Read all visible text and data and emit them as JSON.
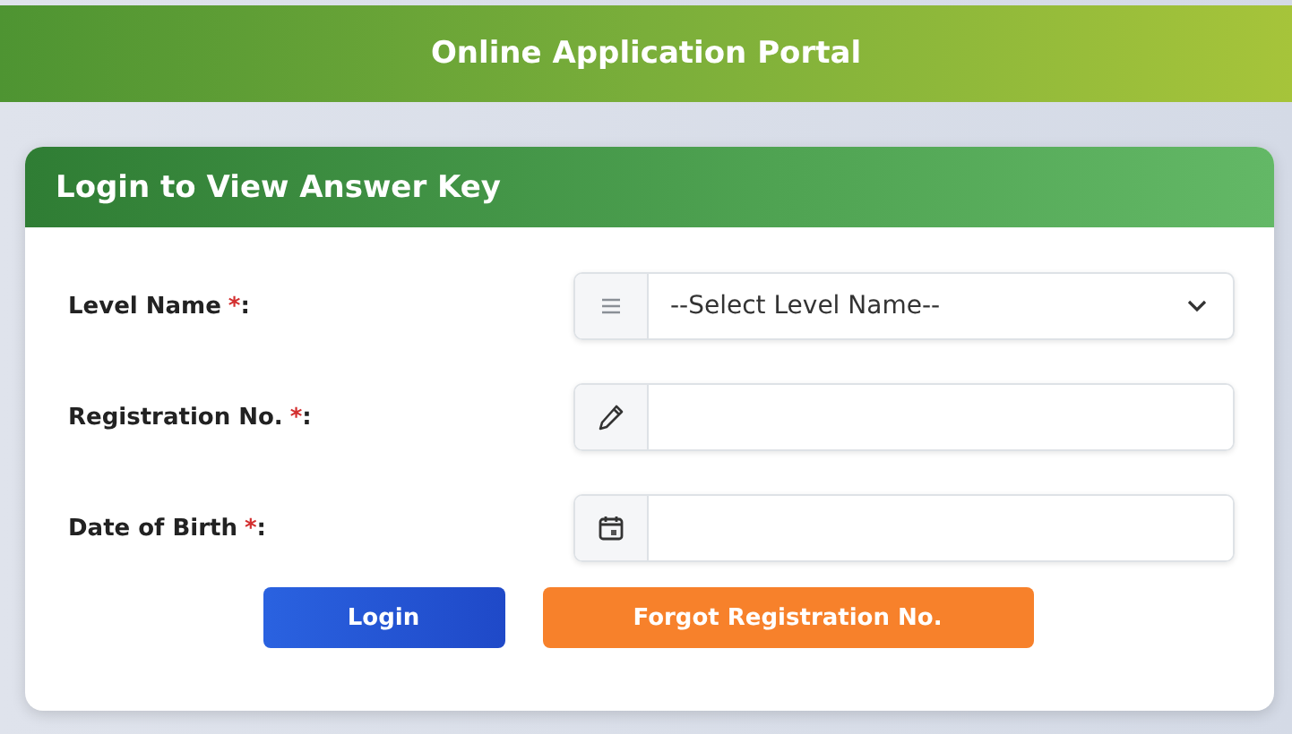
{
  "top_bar": {
    "title": "Online Application Portal"
  },
  "card": {
    "title": "Login to View Answer Key",
    "fields": [
      {
        "kind": "select",
        "label": "Level Name",
        "required_mark": "*",
        "colon": ":",
        "value": "--Select Level Name--"
      },
      {
        "kind": "text",
        "label": "Registration No.",
        "required_mark": "*",
        "colon": ":"
      },
      {
        "kind": "date",
        "label": "Date of Birth",
        "required_mark": "*",
        "colon": ":"
      }
    ],
    "buttons": [
      {
        "label": "Login",
        "kind": "primary"
      },
      {
        "label": "Forgot Registration No.",
        "kind": "warning"
      }
    ]
  }
}
